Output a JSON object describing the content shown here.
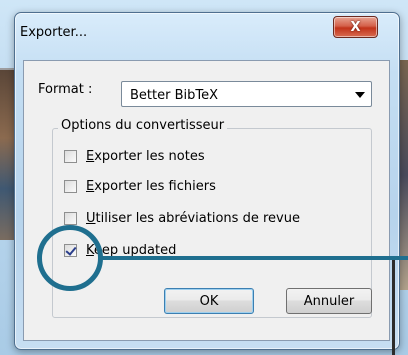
{
  "dialog": {
    "title": "Exporter...",
    "close_glyph": "X",
    "format_label": "Format :",
    "format_value": "Better BibTeX",
    "group_title": "Options du convertisseur",
    "options": [
      {
        "label_first": "E",
        "label_rest": "xporter les notes",
        "checked": false
      },
      {
        "label_first": "E",
        "label_rest": "xporter les fichiers",
        "checked": false
      },
      {
        "label_first": "U",
        "label_rest": "tiliser les abréviations de revue",
        "checked": false
      },
      {
        "label_first": "K",
        "label_rest": "eep updated",
        "checked": true
      }
    ],
    "ok_label": "OK",
    "cancel_label": "Annuler"
  },
  "colors": {
    "annotation": "#1f6f8f",
    "close_button": "#c2331a"
  },
  "icons": {
    "close": "close-x-icon",
    "dropdown": "chevron-down-icon",
    "checkmark": "check-icon"
  }
}
